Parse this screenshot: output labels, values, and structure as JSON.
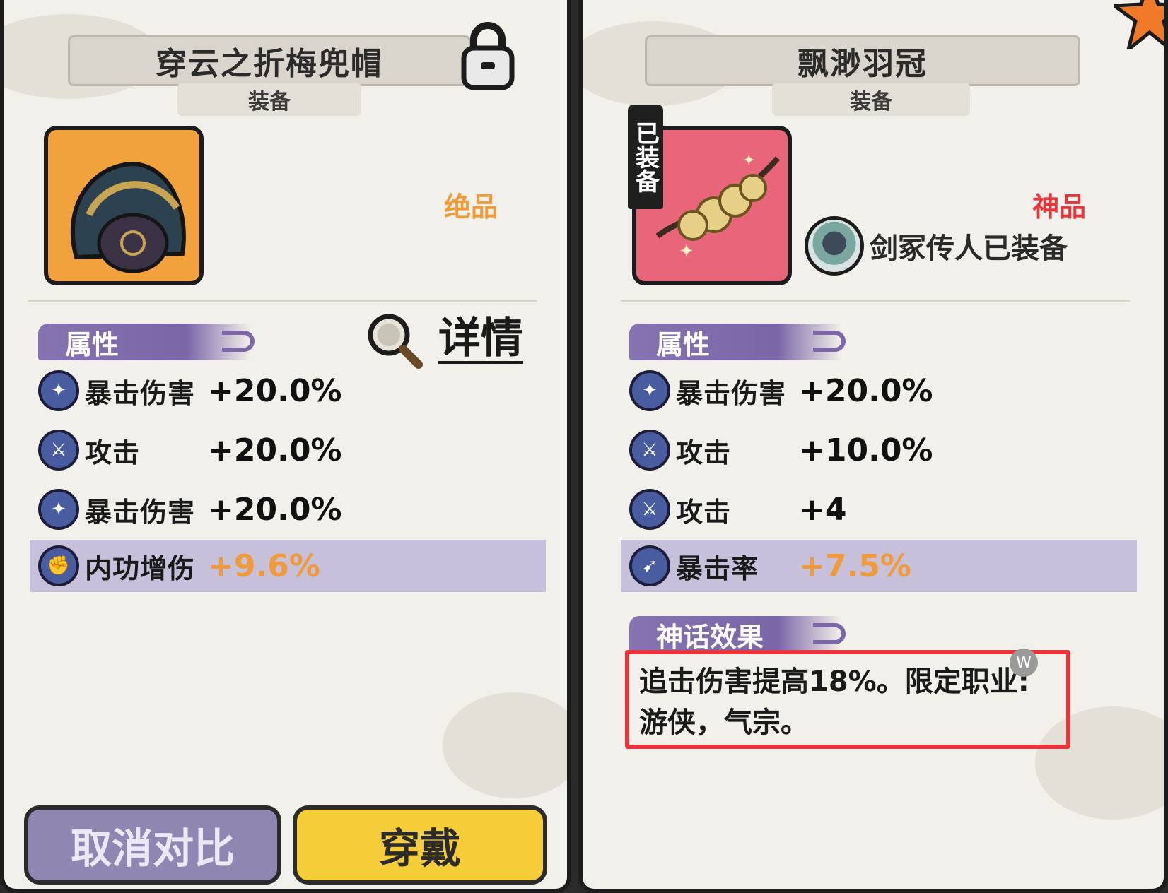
{
  "left_panel": {
    "title": "穿云之折梅兜帽",
    "subtitle": "装备",
    "rarity": "绝品",
    "rarity_color": "#f19a3a",
    "icon_bg": "#f2a23d",
    "attributes_label": "属性",
    "detail_label": "详情",
    "stats": [
      {
        "name": "暴击伤害",
        "value": "+20.0%",
        "icon": "crit-damage-icon",
        "highlight": false
      },
      {
        "name": "攻击",
        "value": "+20.0%",
        "icon": "attack-icon",
        "highlight": false
      },
      {
        "name": "暴击伤害",
        "value": "+20.0%",
        "icon": "crit-damage-icon",
        "highlight": false
      },
      {
        "name": "内功增伤",
        "value": "+9.6%",
        "icon": "inner-power-icon",
        "highlight": true
      }
    ],
    "buttons": {
      "cancel": "取消对比",
      "wear": "穿戴"
    }
  },
  "right_panel": {
    "title": "飘渺羽冠",
    "subtitle": "装备",
    "equipped_tag": "已装备",
    "rarity": "神品",
    "rarity_color": "#e8353c",
    "icon_bg": "#e8657a",
    "owner_text": "剑冢传人已装备",
    "attributes_label": "属性",
    "stats": [
      {
        "name": "暴击伤害",
        "value": "+20.0%",
        "icon": "crit-damage-icon",
        "highlight": false
      },
      {
        "name": "攻击",
        "value": "+10.0%",
        "icon": "attack-icon",
        "highlight": false
      },
      {
        "name": "攻击",
        "value": "+4",
        "icon": "attack-icon",
        "highlight": false
      },
      {
        "name": "暴击率",
        "value": "+7.5%",
        "icon": "crit-rate-icon",
        "highlight": true
      }
    ],
    "myth_label": "神话效果",
    "myth_text_line1": "追击伤害提高18%。限定职业:",
    "myth_text_line2": "游侠，气宗。",
    "badge": "W"
  }
}
